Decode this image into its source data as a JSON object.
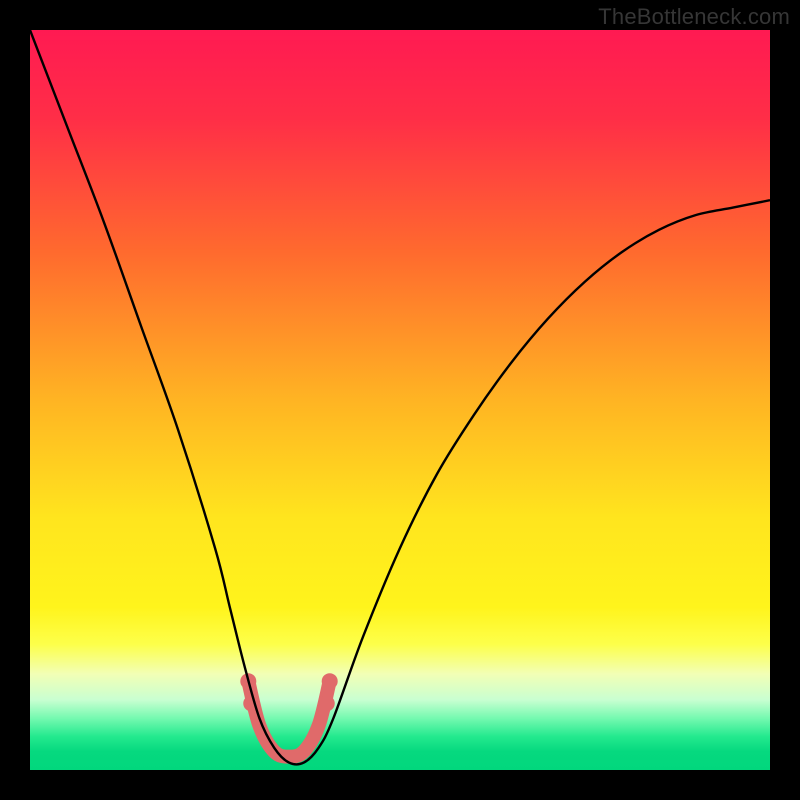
{
  "watermark": "TheBottleneck.com",
  "chart_data": {
    "type": "line",
    "title": "",
    "xlabel": "",
    "ylabel": "",
    "xlim": [
      0,
      100
    ],
    "ylim": [
      0,
      100
    ],
    "grid": false,
    "legend": false,
    "gradient_stops": [
      {
        "pos": 0.0,
        "color": "#ff1a52"
      },
      {
        "pos": 0.12,
        "color": "#ff2e47"
      },
      {
        "pos": 0.3,
        "color": "#ff6a2e"
      },
      {
        "pos": 0.5,
        "color": "#ffb423"
      },
      {
        "pos": 0.66,
        "color": "#ffe51e"
      },
      {
        "pos": 0.78,
        "color": "#fff41c"
      },
      {
        "pos": 0.83,
        "color": "#fdff4a"
      },
      {
        "pos": 0.87,
        "color": "#f2ffb5"
      },
      {
        "pos": 0.905,
        "color": "#c9ffd1"
      },
      {
        "pos": 0.93,
        "color": "#75f9b0"
      },
      {
        "pos": 0.955,
        "color": "#23e98e"
      },
      {
        "pos": 0.975,
        "color": "#06d97f"
      },
      {
        "pos": 1.0,
        "color": "#02d77d"
      }
    ],
    "series": [
      {
        "name": "bottleneck-curve",
        "color": "#000000",
        "x": [
          0,
          5,
          10,
          15,
          20,
          25,
          27,
          29,
          31,
          33,
          35,
          37,
          39,
          41,
          45,
          50,
          55,
          60,
          65,
          70,
          75,
          80,
          85,
          90,
          95,
          100
        ],
        "y": [
          100,
          87,
          74,
          60,
          46,
          30,
          22,
          14,
          7,
          3,
          1,
          1,
          3,
          7,
          18,
          30,
          40,
          48,
          55,
          61,
          66,
          70,
          73,
          75,
          76,
          77
        ]
      },
      {
        "name": "highlight-band",
        "color": "#e06a6a",
        "x": [
          29.5,
          31,
          33,
          35,
          37,
          39,
          40.5
        ],
        "y": [
          12,
          6,
          2.5,
          1.8,
          2.5,
          6,
          12
        ]
      }
    ],
    "highlight_dots": {
      "color": "#e06a6a",
      "points": [
        {
          "x": 29.5,
          "y": 12
        },
        {
          "x": 29.9,
          "y": 9
        },
        {
          "x": 40.1,
          "y": 9
        },
        {
          "x": 40.5,
          "y": 12
        }
      ]
    }
  }
}
